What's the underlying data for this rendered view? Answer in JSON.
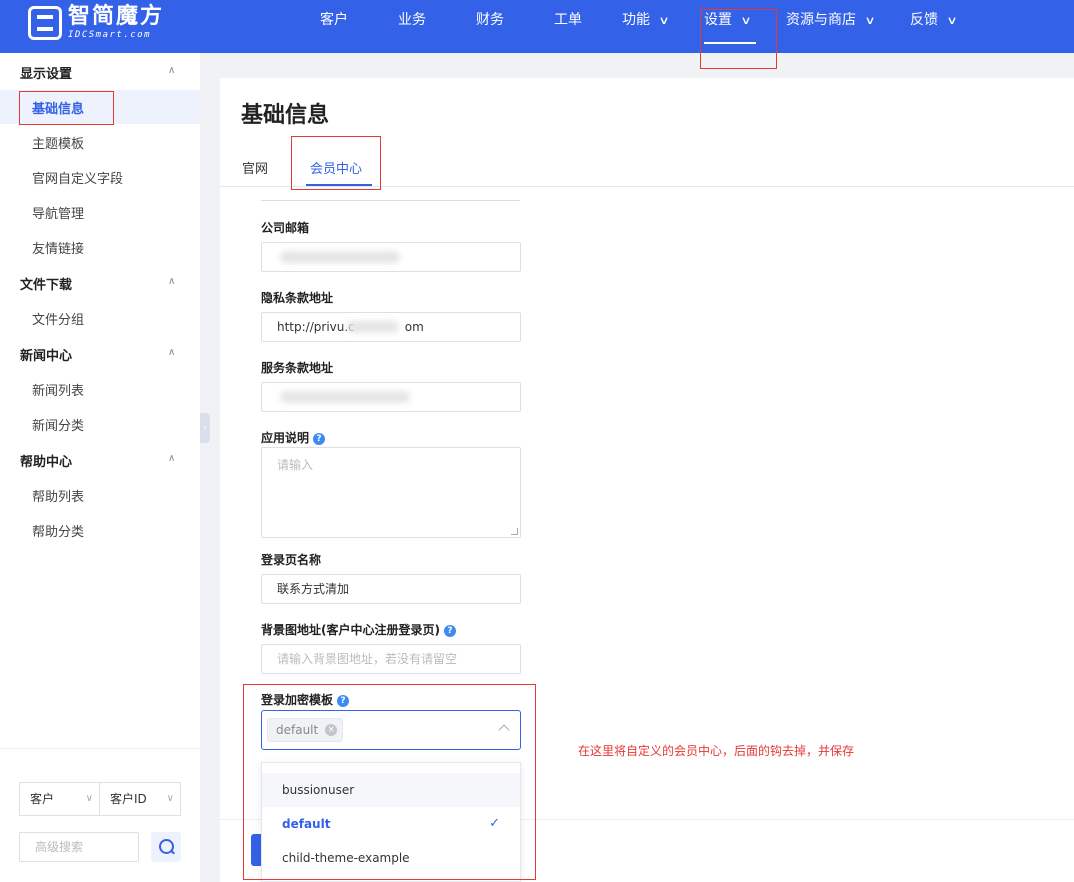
{
  "brand": {
    "name_cn": "智简魔方",
    "name_en": "IDCSmart.com"
  },
  "nav": {
    "items": [
      {
        "label": "客户",
        "dropdown": false
      },
      {
        "label": "业务",
        "dropdown": false
      },
      {
        "label": "财务",
        "dropdown": false
      },
      {
        "label": "工单",
        "dropdown": false
      },
      {
        "label": "功能",
        "dropdown": true
      },
      {
        "label": "设置",
        "dropdown": true,
        "active": true
      },
      {
        "label": "资源与商店",
        "dropdown": true
      },
      {
        "label": "反馈",
        "dropdown": true
      }
    ]
  },
  "sidebar": {
    "groups": [
      {
        "title": "显示设置",
        "items": [
          "基础信息",
          "主题模板",
          "官网自定义字段",
          "导航管理",
          "友情链接"
        ]
      },
      {
        "title": "文件下载",
        "items": [
          "文件分组"
        ]
      },
      {
        "title": "新闻中心",
        "items": [
          "新闻列表",
          "新闻分类"
        ]
      },
      {
        "title": "帮助中心",
        "items": [
          "帮助列表",
          "帮助分类"
        ]
      }
    ],
    "active_item": "基础信息",
    "filter": {
      "select1": "客户",
      "select2": "客户ID",
      "search_placeholder": "高级搜索"
    }
  },
  "page": {
    "title": "基础信息",
    "tabs": [
      {
        "label": "官网"
      },
      {
        "label": "会员中心",
        "active": true
      }
    ]
  },
  "form": {
    "company_email": {
      "label": "公司邮箱",
      "value": ""
    },
    "privacy_url": {
      "label": "隐私条款地址",
      "value_start": "http://privu.c",
      "value_end": "om"
    },
    "terms_url": {
      "label": "服务条款地址",
      "value": ""
    },
    "app_desc": {
      "label": "应用说明",
      "placeholder": "请输入"
    },
    "login_page_name": {
      "label": "登录页名称",
      "value": "联系方式清加"
    },
    "bg_url": {
      "label": "背景图地址(客户中心注册登录页)",
      "placeholder": "请输入背景图地址，若没有请留空"
    },
    "login_template": {
      "label": "登录加密模板",
      "selected_tag": "default",
      "options": [
        {
          "label": "bussionuser",
          "hover": true
        },
        {
          "label": "default",
          "selected": true
        },
        {
          "label": "child-theme-example"
        }
      ]
    }
  },
  "icons": {
    "help": "?",
    "check": "✓",
    "close": "×",
    "chevron": "∨",
    "caret_up": "∧"
  },
  "annotation": {
    "text": "在这里将自定义的会员中心，后面的钩去掉，并保存",
    "color": "#e53935"
  },
  "colors": {
    "primary": "#3361e8",
    "highlight": "#e53935"
  }
}
